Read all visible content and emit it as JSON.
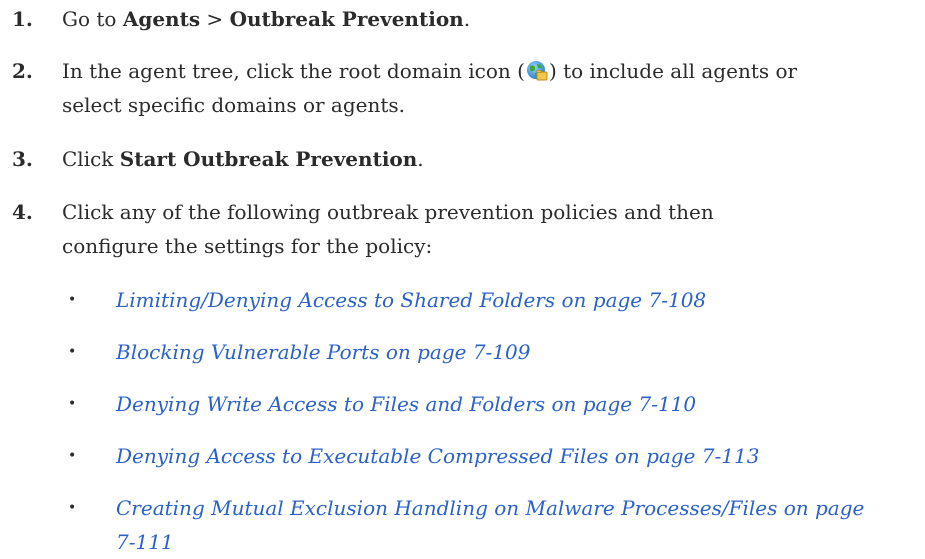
{
  "steps": [
    {
      "number": "1.",
      "pre": "Go to ",
      "bold1": "Agents",
      "sep": " > ",
      "bold2": "Outbreak Prevention",
      "post": "."
    },
    {
      "number": "2.",
      "pre": "In the agent tree, click the root domain icon (",
      "icon": "root-domain-globe-icon",
      "post": ") to include all agents or",
      "line2": "select specific domains or agents."
    },
    {
      "number": "3.",
      "pre": "Click ",
      "bold1": "Start Outbreak Prevention",
      "post": "."
    },
    {
      "number": "4.",
      "line1": "Click any of the following outbreak prevention policies and then",
      "line2": "configure the settings for the policy:"
    }
  ],
  "links": [
    {
      "line1": "Limiting/Denying Access to Shared Folders on page 7-108"
    },
    {
      "line1": "Blocking Vulnerable Ports on page 7-109"
    },
    {
      "line1": "Denying Write Access to Files and Folders on page 7-110"
    },
    {
      "line1": "Denying Access to Executable Compressed Files on page 7-113"
    },
    {
      "line1": "Creating Mutual Exclusion Handling on Malware Processes/Files on page",
      "line2": "7-111"
    }
  ],
  "bullet_char": "•",
  "colors": {
    "link": "#2a62c8",
    "text": "#2b2b2b"
  }
}
